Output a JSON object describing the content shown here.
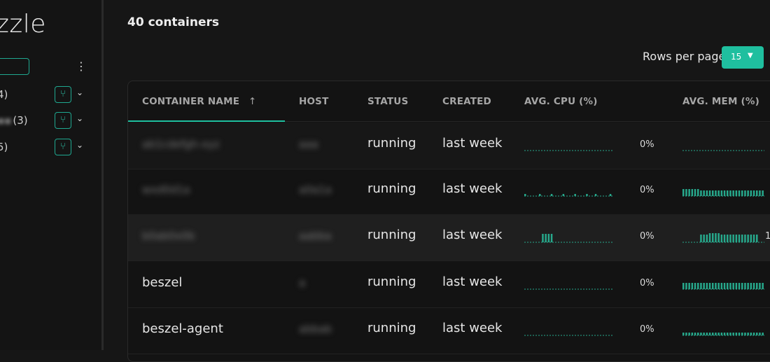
{
  "sidebar": {
    "brand": "zzle",
    "groups": [
      {
        "label": "4)"
      },
      {
        "label": "(3)"
      },
      {
        "label": "5)"
      }
    ]
  },
  "main": {
    "title": "40 containers",
    "rows_per_page_label": "Rows per page",
    "rows_per_page_value": "15"
  },
  "table": {
    "columns": [
      "CONTAINER NAME",
      "HOST",
      "STATUS",
      "CREATED",
      "AVG. CPU (%)",
      "AVG. MEM (%)"
    ],
    "sort_icon": "arrow-up-icon",
    "rows": [
      {
        "name": "",
        "status": "running",
        "created": "last week",
        "cpu": "0%",
        "mem": ""
      },
      {
        "name": "",
        "status": "running",
        "created": "last week",
        "cpu": "0%",
        "mem": ""
      },
      {
        "name": "",
        "status": "running",
        "created": "last week",
        "cpu": "0%",
        "mem": "1"
      },
      {
        "name": "beszel",
        "status": "running",
        "created": "last week",
        "cpu": "0%",
        "mem": ""
      },
      {
        "name": "beszel-agent",
        "status": "running",
        "created": "last week",
        "cpu": "0%",
        "mem": ""
      }
    ]
  },
  "colors": {
    "accent": "#1fbf9f",
    "spark": "#27a98c"
  }
}
